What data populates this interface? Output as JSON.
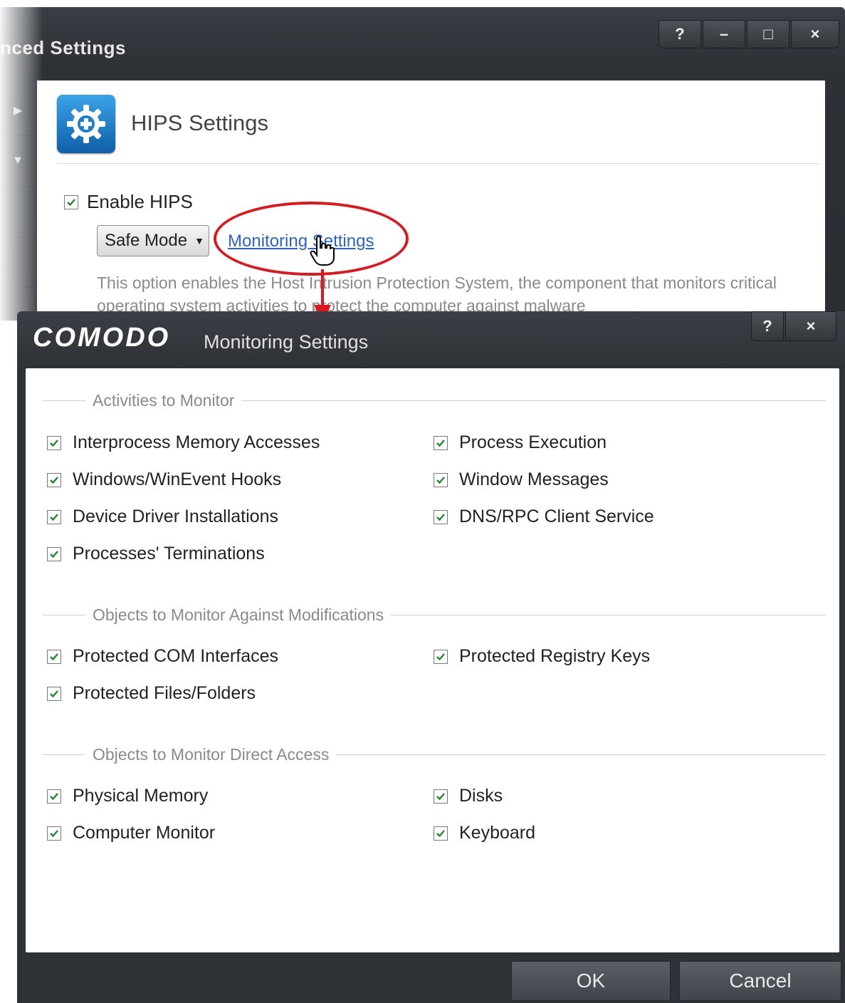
{
  "background_window": {
    "title": "nced Settings",
    "controls": {
      "help": "?",
      "minimize": "–",
      "maximize": "□",
      "close": "×"
    },
    "panel": {
      "icon": "hips-gear-icon",
      "title": "HIPS Settings",
      "enable_label": "Enable HIPS",
      "enable_checked": true,
      "mode_value": "Safe Mode",
      "monitoring_link": "Monitoring Settings",
      "description": "This option enables the Host Intrusion Protection System, the component that monitors critical operating system activities to protect the computer against malware"
    }
  },
  "dialog": {
    "brand": "COMODO",
    "title": "Monitoring Settings",
    "controls": {
      "help": "?",
      "close": "×"
    },
    "sections": [
      {
        "heading": "Activities to Monitor",
        "options": [
          {
            "label": "Interprocess Memory Accesses",
            "checked": true
          },
          {
            "label": "Process Execution",
            "checked": true
          },
          {
            "label": "Windows/WinEvent Hooks",
            "checked": true
          },
          {
            "label": "Window Messages",
            "checked": true
          },
          {
            "label": "Device Driver Installations",
            "checked": true
          },
          {
            "label": "DNS/RPC Client Service",
            "checked": true
          },
          {
            "label": "Processes' Terminations",
            "checked": true
          }
        ]
      },
      {
        "heading": "Objects to Monitor Against Modifications",
        "options": [
          {
            "label": "Protected COM Interfaces",
            "checked": true
          },
          {
            "label": "Protected Registry Keys",
            "checked": true
          },
          {
            "label": "Protected Files/Folders",
            "checked": true
          }
        ]
      },
      {
        "heading": "Objects to Monitor Direct Access",
        "options": [
          {
            "label": "Physical Memory",
            "checked": true
          },
          {
            "label": "Disks",
            "checked": true
          },
          {
            "label": "Computer Monitor",
            "checked": true
          },
          {
            "label": "Keyboard",
            "checked": true
          }
        ]
      }
    ],
    "buttons": {
      "ok": "OK",
      "cancel": "Cancel"
    }
  },
  "colors": {
    "link": "#2a62d6",
    "annotation": "#e0161c",
    "checkmark": "#1f8a2e",
    "dialog_frame": "#2e3237"
  }
}
